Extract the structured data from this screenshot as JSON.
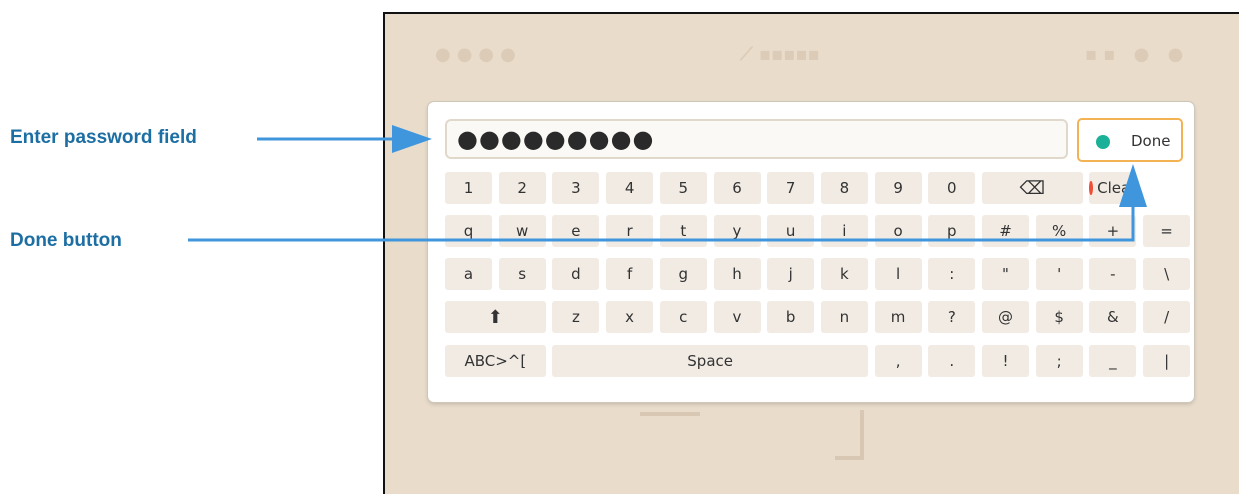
{
  "callouts": {
    "password_field": "Enter password field",
    "done_button": "Done button"
  },
  "background": {
    "status_left": "●●●●",
    "status_center": "⟋ ▪▪▪▪▪",
    "status_right": "▪▪ ● ●"
  },
  "keyboard": {
    "password_value": "●●●●●●●●●",
    "done_label": "Done",
    "rows": [
      [
        "1",
        "2",
        "3",
        "4",
        "5",
        "6",
        "7",
        "8",
        "9",
        "0",
        "⌫",
        "Clear"
      ],
      [
        "q",
        "w",
        "e",
        "r",
        "t",
        "y",
        "u",
        "i",
        "o",
        "p",
        "#",
        "%",
        "+",
        "="
      ],
      [
        "a",
        "s",
        "d",
        "f",
        "g",
        "h",
        "j",
        "k",
        "l",
        ":",
        "\"",
        "'",
        "-",
        "\\"
      ],
      [
        "⬆",
        "z",
        "x",
        "c",
        "v",
        "b",
        "n",
        "m",
        "?",
        "@",
        "$",
        "&",
        "/"
      ],
      [
        "ABC>^[",
        "Space",
        ",",
        ".",
        "!",
        ";",
        "_",
        "|"
      ]
    ]
  },
  "colors": {
    "done_dot": "#1bb199",
    "clear_dot": "#f04e37",
    "callout_text": "#1d6fa3",
    "arrow": "#3f96dd",
    "focus_border": "#f3b254"
  }
}
